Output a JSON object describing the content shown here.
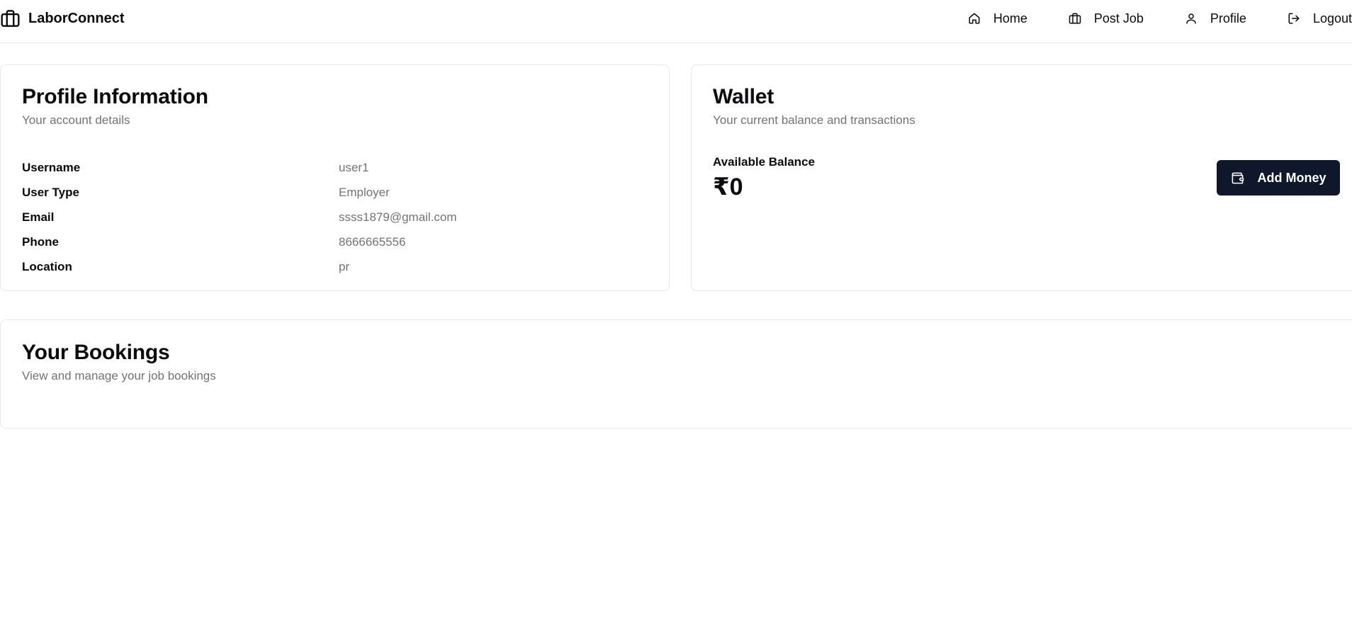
{
  "nav": {
    "brand": "LaborConnect",
    "brand_icon": "briefcase-icon",
    "links": [
      {
        "label": "Home",
        "icon": "home-icon"
      },
      {
        "label": "Post Job",
        "icon": "briefcase-icon"
      },
      {
        "label": "Profile",
        "icon": "user-icon"
      },
      {
        "label": "Logout",
        "icon": "logout-icon"
      }
    ]
  },
  "profile": {
    "title": "Profile Information",
    "subtitle": "Your account details",
    "fields": [
      {
        "label": "Username",
        "value": "user1"
      },
      {
        "label": "User Type",
        "value": "Employer"
      },
      {
        "label": "Email",
        "value": "ssss1879@gmail.com"
      },
      {
        "label": "Phone",
        "value": "8666665556"
      },
      {
        "label": "Location",
        "value": "pr"
      }
    ]
  },
  "wallet": {
    "title": "Wallet",
    "subtitle": "Your current balance and transactions",
    "balance_label": "Available Balance",
    "balance": "₹0",
    "add_money_label": "Add Money",
    "add_money_icon": "wallet-icon"
  },
  "bookings": {
    "title": "Your Bookings",
    "subtitle": "View and manage your job bookings"
  },
  "colors": {
    "primary_button": "#0f172a",
    "muted_text": "#737373",
    "border": "#e5e7eb"
  }
}
